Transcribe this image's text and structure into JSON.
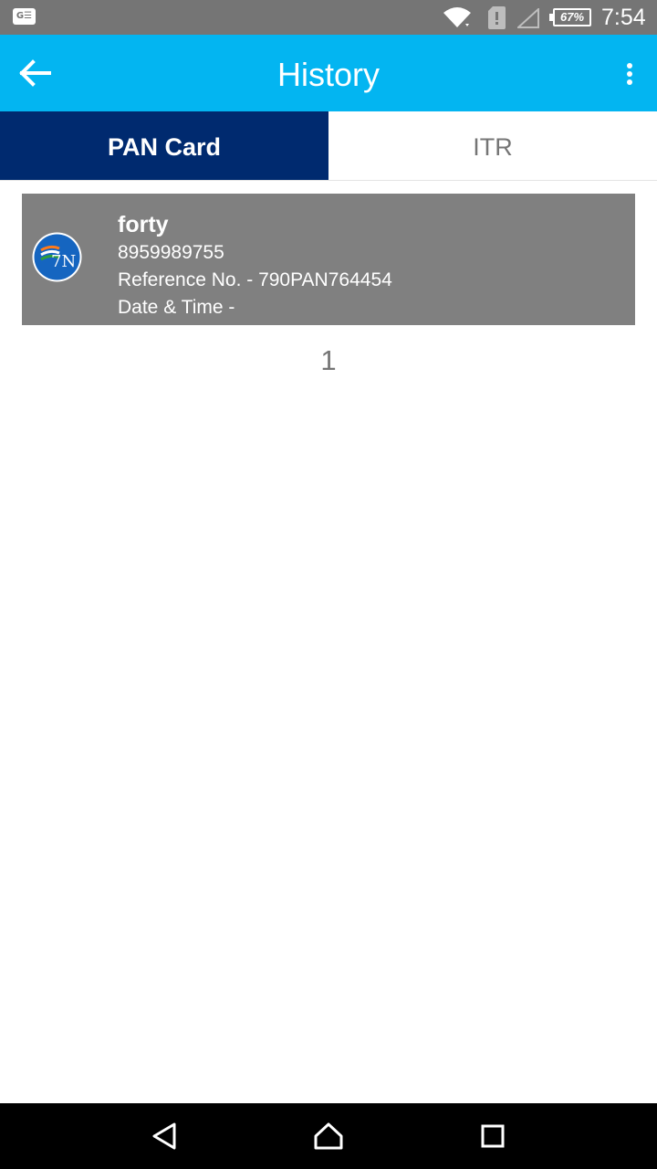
{
  "status_bar": {
    "left_icon": "G☰",
    "battery": "67%",
    "time": "7:54",
    "icons": [
      "notification-icon",
      "wifi-icon",
      "sim-alert-icon",
      "signal-icon",
      "battery-icon"
    ]
  },
  "app_bar": {
    "title": "History",
    "back_icon": "arrow-left-icon",
    "menu_icon": "more-vert-icon",
    "color": "#03b5f1"
  },
  "tabs": [
    {
      "label": "PAN Card",
      "selected": true,
      "color": "#002a6f"
    },
    {
      "label": "ITR",
      "selected": false
    }
  ],
  "history_items": [
    {
      "name": "forty",
      "phone": "8959989755",
      "reference": "Reference No. - 790PAN764454",
      "datetime": "Date & Time -",
      "logo_text": "7N"
    }
  ],
  "pagination": {
    "page": "1"
  },
  "nav_bar": {
    "icons": [
      "back-triangle-icon",
      "home-icon",
      "recents-icon"
    ]
  }
}
